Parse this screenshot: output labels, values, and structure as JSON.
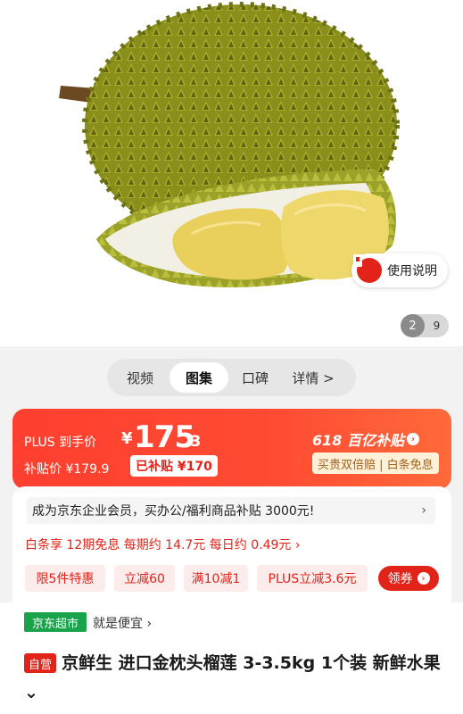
{
  "gallery": {
    "manual_label": "使用说明",
    "page_current": "2",
    "page_total": "9"
  },
  "tabs": [
    "视频",
    "图集",
    "口碑",
    "详情 >"
  ],
  "price": {
    "plus_label": "PLUS 到手价",
    "currency": "¥",
    "main": "175",
    "decimal": ".3",
    "subsidy_label": "补贴价 ¥179.9",
    "subsidy_tag": "已补贴 ¥170",
    "promo_618": "618 百亿补贴",
    "promo_tags": "买贵双倍赔 | 白条免息"
  },
  "info": {
    "enterprise": "成为京东企业会员，买办公/福利商品补贴 3000元!",
    "installment": "白条享 12期免息 每期约 14.7元 每日约 0.49元 ›",
    "chips": [
      "限5件特惠",
      "立减60",
      "满10减1",
      "PLUS立减3.6元"
    ],
    "coupon": "领券"
  },
  "product": {
    "store_badge": "京东超市",
    "store_slogan": "就是便宜 ›",
    "self_tag": "自营",
    "title": "京鲜生 进口金枕头榴莲 3-3.5kg 1个装 新鲜水果 ⌄"
  },
  "colors": {
    "accent": "#e2231a",
    "price_card": "#ff3f2f",
    "store_green": "#19a34a"
  }
}
